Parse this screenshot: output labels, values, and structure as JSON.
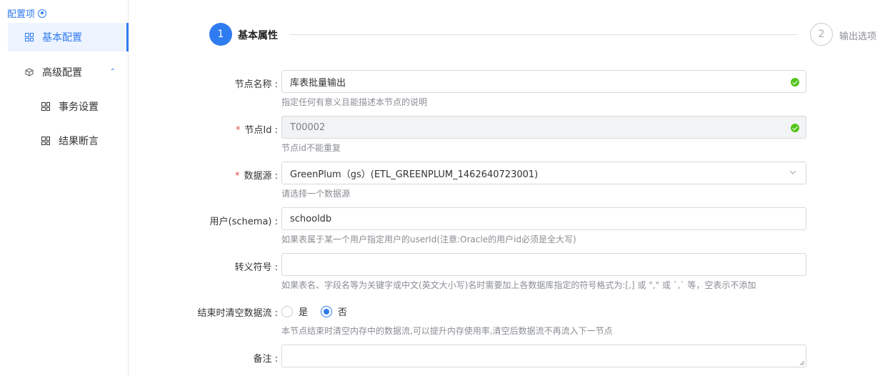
{
  "sidebar": {
    "header": "配置项",
    "items": [
      {
        "label": "基本配置"
      },
      {
        "label": "高级配置"
      },
      {
        "label": "事务设置"
      },
      {
        "label": "结果断言"
      }
    ]
  },
  "steps": [
    {
      "number": "1",
      "title": "基本属性",
      "state": "active"
    },
    {
      "number": "2",
      "title": "输出选项",
      "state": "pending"
    }
  ],
  "form": {
    "node_name": {
      "label": "节点名称 :",
      "value": "库表批量输出",
      "hint": "指定任何有意义且能描述本节点的说明"
    },
    "node_id": {
      "required": "*",
      "label": "节点Id :",
      "value": "T00002",
      "hint": "节点id不能重复"
    },
    "datasource": {
      "required": "*",
      "label": "数据源 :",
      "value": "GreenPlum（gs）(ETL_GREENPLUM_1462640723001)",
      "hint": "请选择一个数据源"
    },
    "user": {
      "label": "用户(schema) :",
      "value": "schooldb",
      "hint": "如果表属于某一个用户指定用户的userId(注意:Oracle的用户id必须是全大写)"
    },
    "escape": {
      "label": "转义符号 :",
      "value": "",
      "hint": "如果表名、字段名等为关键字或中文(英文大小写)名时需要加上各数据库指定的符号格式为:[,] 或 \",\" 或 `,` 等，空表示不添加"
    },
    "clear_stream": {
      "label": "结束时清空数据流 :",
      "options": [
        "是",
        "否"
      ],
      "selected": "否",
      "hint": "本节点结束时清空内存中的数据流,可以提升内存使用率,清空后数据流不再流入下一节点"
    },
    "remark": {
      "label": "备注 :",
      "value": ""
    }
  },
  "colors": {
    "accent": "#2f7bf0",
    "success": "#52c41a",
    "required": "#e34d4d"
  }
}
